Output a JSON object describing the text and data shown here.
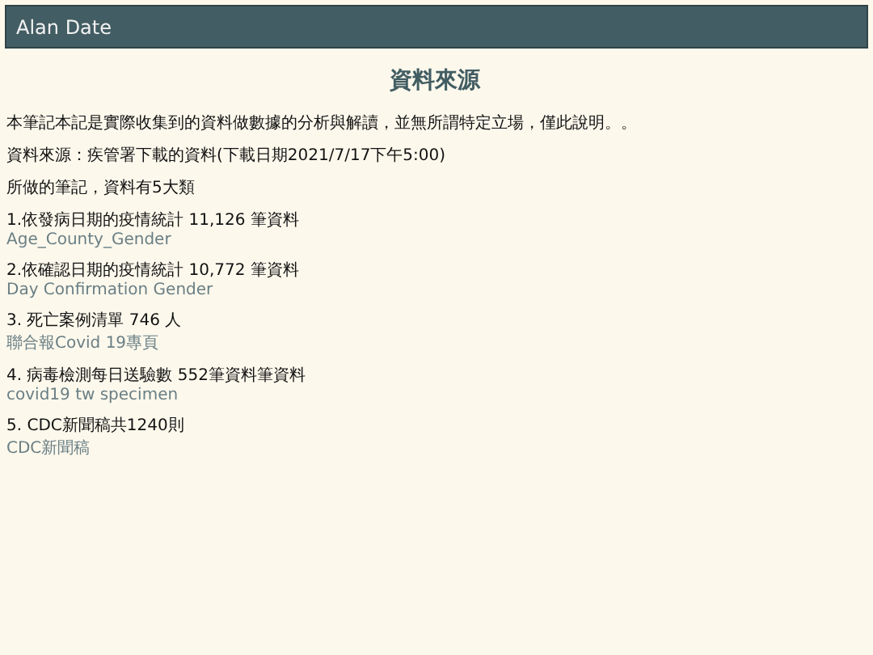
{
  "header": {
    "title": "Alan Date"
  },
  "page_title": "資料來源",
  "paragraphs": [
    "本筆記本記是實際收集到的資料做數據的分析與解讀，並無所謂特定立場，僅此說明。。",
    "資料來源：疾管署下載的資料(下載日期2021/7/17下午5:00)",
    "所做的筆記，資料有5大類"
  ],
  "datasets": [
    {
      "title": "1.依發病日期的疫情統計 11,126 筆資料",
      "subtitle": "Age_County_Gender"
    },
    {
      "title": "2.依確認日期的疫情統計 10,772 筆資料",
      "subtitle": "Day Confirmation Gender"
    },
    {
      "title": "3. 死亡案例清單 746 人",
      "subtitle": "聯合報Covid 19專頁"
    },
    {
      "title": "4. 病毒檢測每日送驗數 552筆資料筆資料",
      "subtitle": "covid19 tw specimen"
    },
    {
      "title": "5. CDC新聞稿共1240則",
      "subtitle": "CDC新聞稿"
    }
  ]
}
